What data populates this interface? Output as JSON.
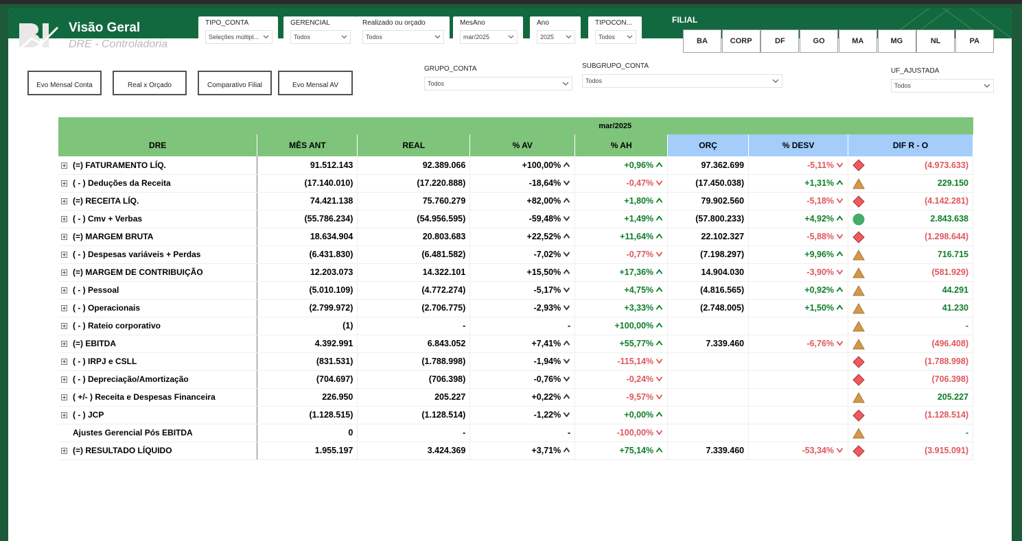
{
  "header": {
    "title": "Visão Geral",
    "subtitle": "DRE - Controladoria",
    "filial_title": "FILIAL"
  },
  "slicers": [
    {
      "label": "TIPO_CONTA",
      "value": "Seleções múltipl..."
    },
    {
      "label": "GERENCIAL",
      "value": "Todos"
    },
    {
      "label": "Realizado ou orçado",
      "value": "Todos"
    },
    {
      "label": "MesAno",
      "value": "mar/2025"
    },
    {
      "label": "Ano",
      "value": "2025"
    },
    {
      "label": "TIPOCON...",
      "value": "Todos"
    }
  ],
  "filial_buttons": [
    "BA",
    "CORP",
    "DF",
    "GO",
    "MA",
    "MG",
    "NL",
    "PA"
  ],
  "nav_buttons": [
    "Evo Mensal Conta",
    "Real x Orçado",
    "Comparativo Filial",
    "Evo Mensal AV"
  ],
  "slicers2": [
    {
      "label": "GRUPO_CONTA",
      "value": "Todos"
    },
    {
      "label": "SUBGRUPO_CONTA",
      "value": "Todos"
    },
    {
      "label": "UF_AJUSTADA",
      "value": "Todos"
    }
  ],
  "colors": {
    "positive": "#0d7d27",
    "negative": "#e0565b",
    "header_green": "#7fc47b",
    "header_blue": "#a4cdfb"
  },
  "matrix": {
    "period": "mar/2025",
    "columns": [
      "DRE",
      "MÊS ANT",
      "REAL",
      "% AV",
      "% AH",
      "ORÇ",
      "% DESV",
      "DIF R - O"
    ],
    "rows": [
      {
        "name": "(=) FATURAMENTO LÍQ.",
        "exp": true,
        "mes_ant": "91.512.143",
        "real": "92.389.066",
        "av": "+100,00%",
        "av_dir": "up",
        "ah": "+0,96%",
        "ah_s": "pos",
        "orc": "97.362.699",
        "desv": "-5,11%",
        "desv_s": "neg",
        "ind": "diamond",
        "dif": "(4.973.633)",
        "dif_s": "neg"
      },
      {
        "name": "( - ) Deduções da Receita",
        "exp": true,
        "mes_ant": "(17.140.010)",
        "real": "(17.220.888)",
        "av": "-18,64%",
        "av_dir": "down",
        "ah": "-0,47%",
        "ah_s": "neg",
        "orc": "(17.450.038)",
        "desv": "+1,31%",
        "desv_s": "pos",
        "ind": "triangle",
        "dif": "229.150",
        "dif_s": "pos"
      },
      {
        "name": "(=) RECEITA LÍQ.",
        "exp": true,
        "mes_ant": "74.421.138",
        "real": "75.760.279",
        "av": "+82,00%",
        "av_dir": "up",
        "ah": "+1,80%",
        "ah_s": "pos",
        "orc": "79.902.560",
        "desv": "-5,18%",
        "desv_s": "neg",
        "ind": "diamond",
        "dif": "(4.142.281)",
        "dif_s": "neg"
      },
      {
        "name": "( - ) Cmv + Verbas",
        "exp": true,
        "mes_ant": "(55.786.234)",
        "real": "(54.956.595)",
        "av": "-59,48%",
        "av_dir": "down",
        "ah": "+1,49%",
        "ah_s": "pos",
        "orc": "(57.800.233)",
        "desv": "+4,92%",
        "desv_s": "pos",
        "ind": "circle",
        "dif": "2.843.638",
        "dif_s": "pos"
      },
      {
        "name": "(=) MARGEM BRUTA",
        "exp": true,
        "mes_ant": "18.634.904",
        "real": "20.803.683",
        "av": "+22,52%",
        "av_dir": "up",
        "ah": "+11,64%",
        "ah_s": "pos",
        "orc": "22.102.327",
        "desv": "-5,88%",
        "desv_s": "neg",
        "ind": "diamond",
        "dif": "(1.298.644)",
        "dif_s": "neg"
      },
      {
        "name": "( - ) Despesas variáveis + Perdas",
        "exp": true,
        "mes_ant": "(6.431.830)",
        "real": "(6.481.582)",
        "av": "-7,02%",
        "av_dir": "down",
        "ah": "-0,77%",
        "ah_s": "neg",
        "orc": "(7.198.297)",
        "desv": "+9,96%",
        "desv_s": "pos",
        "ind": "triangle",
        "dif": "716.715",
        "dif_s": "pos"
      },
      {
        "name": "(=) MARGEM DE CONTRIBUIÇÃO",
        "exp": true,
        "mes_ant": "12.203.073",
        "real": "14.322.101",
        "av": "+15,50%",
        "av_dir": "up",
        "ah": "+17,36%",
        "ah_s": "pos",
        "orc": "14.904.030",
        "desv": "-3,90%",
        "desv_s": "neg",
        "ind": "triangle",
        "dif": "(581.929)",
        "dif_s": "neg"
      },
      {
        "name": "( - ) Pessoal",
        "exp": true,
        "mes_ant": "(5.010.109)",
        "real": "(4.772.274)",
        "av": "-5,17%",
        "av_dir": "down",
        "ah": "+4,75%",
        "ah_s": "pos",
        "orc": "(4.816.565)",
        "desv": "+0,92%",
        "desv_s": "pos",
        "ind": "triangle",
        "dif": "44.291",
        "dif_s": "pos"
      },
      {
        "name": "( - ) Operacionais",
        "exp": true,
        "mes_ant": "(2.799.972)",
        "real": "(2.706.775)",
        "av": "-2,93%",
        "av_dir": "down",
        "ah": "+3,33%",
        "ah_s": "pos",
        "orc": "(2.748.005)",
        "desv": "+1,50%",
        "desv_s": "pos",
        "ind": "triangle",
        "dif": "41.230",
        "dif_s": "pos"
      },
      {
        "name": "( - ) Rateio corporativo",
        "exp": true,
        "mes_ant": "(1)",
        "real": "-",
        "av": "-",
        "av_dir": "",
        "ah": "+100,00%",
        "ah_s": "pos",
        "orc": "",
        "desv": "",
        "desv_s": "",
        "ind": "triangle",
        "dif": "-",
        "dif_s": "pos"
      },
      {
        "name": "(=) EBITDA",
        "exp": true,
        "mes_ant": "4.392.991",
        "real": "6.843.052",
        "av": "+7,41%",
        "av_dir": "up",
        "ah": "+55,77%",
        "ah_s": "pos",
        "orc": "7.339.460",
        "desv": "-6,76%",
        "desv_s": "neg",
        "ind": "triangle",
        "dif": "(496.408)",
        "dif_s": "neg"
      },
      {
        "name": "( - ) IRPJ e CSLL",
        "exp": true,
        "mes_ant": "(831.531)",
        "real": "(1.788.998)",
        "av": "-1,94%",
        "av_dir": "down",
        "ah": "-115,14%",
        "ah_s": "neg",
        "orc": "",
        "desv": "",
        "desv_s": "",
        "ind": "diamond",
        "dif": "(1.788.998)",
        "dif_s": "neg"
      },
      {
        "name": "( - ) Depreciação/Amortização",
        "exp": true,
        "mes_ant": "(704.697)",
        "real": "(706.398)",
        "av": "-0,76%",
        "av_dir": "down",
        "ah": "-0,24%",
        "ah_s": "neg",
        "orc": "",
        "desv": "",
        "desv_s": "",
        "ind": "diamond",
        "dif": "(706.398)",
        "dif_s": "neg"
      },
      {
        "name": "( +/- ) Receita e Despesas Financeira",
        "exp": true,
        "mes_ant": "226.950",
        "real": "205.227",
        "av": "+0,22%",
        "av_dir": "up",
        "ah": "-9,57%",
        "ah_s": "neg",
        "orc": "",
        "desv": "",
        "desv_s": "",
        "ind": "triangle",
        "dif": "205.227",
        "dif_s": "pos"
      },
      {
        "name": "( - ) JCP",
        "exp": true,
        "mes_ant": "(1.128.515)",
        "real": "(1.128.514)",
        "av": "-1,22%",
        "av_dir": "down",
        "ah": "+0,00%",
        "ah_s": "pos",
        "orc": "",
        "desv": "",
        "desv_s": "",
        "ind": "diamond",
        "dif": "(1.128.514)",
        "dif_s": "neg"
      },
      {
        "name": "Ajustes Gerencial Pós EBITDA",
        "exp": false,
        "mes_ant": "0",
        "real": "-",
        "av": "-",
        "av_dir": "",
        "ah": "-100,00%",
        "ah_s": "neg",
        "orc": "",
        "desv": "",
        "desv_s": "",
        "ind": "triangle",
        "dif": "-",
        "dif_s": "pos"
      },
      {
        "name": "(=) RESULTADO LÍQUIDO",
        "exp": true,
        "mes_ant": "1.955.197",
        "real": "3.424.369",
        "av": "+3,71%",
        "av_dir": "up",
        "ah": "+75,14%",
        "ah_s": "pos",
        "orc": "7.339.460",
        "desv": "-53,34%",
        "desv_s": "neg",
        "ind": "diamond",
        "dif": "(3.915.091)",
        "dif_s": "neg"
      }
    ]
  }
}
